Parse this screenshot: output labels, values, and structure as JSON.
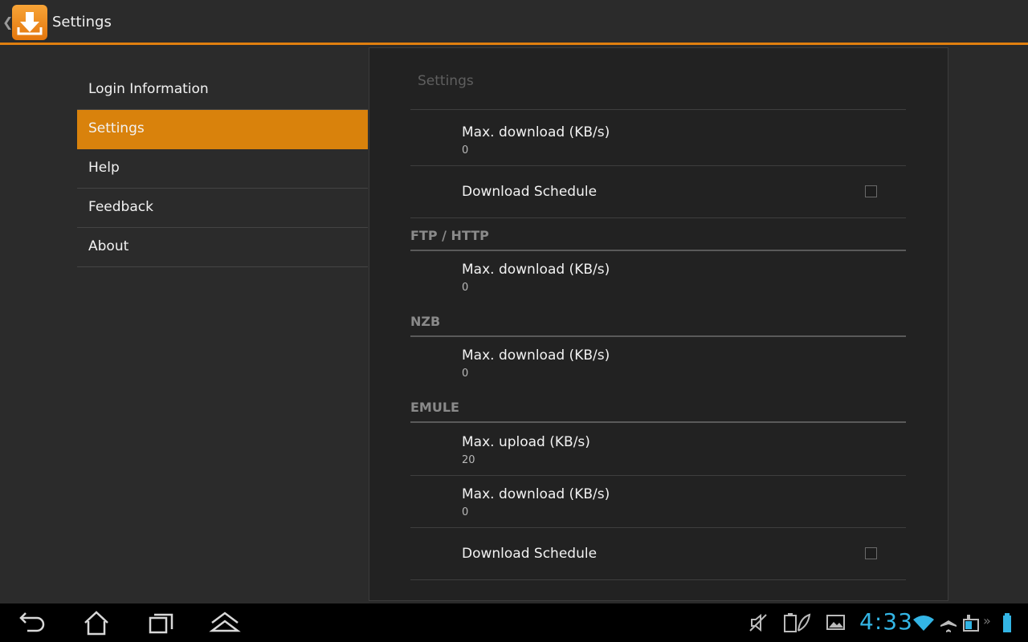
{
  "actionbar": {
    "title": "Settings"
  },
  "sidebar": {
    "items": [
      {
        "label": "Login Information",
        "selected": false
      },
      {
        "label": "Settings",
        "selected": true
      },
      {
        "label": "Help",
        "selected": false
      },
      {
        "label": "Feedback",
        "selected": false
      },
      {
        "label": "About",
        "selected": false
      }
    ]
  },
  "panel": {
    "title": "Settings",
    "prefs": [
      {
        "title": "Max. download (KB/s)",
        "summary": "0"
      },
      {
        "title": "Download Schedule",
        "checked": false
      }
    ],
    "categories": [
      {
        "name": "FTP / HTTP",
        "prefs": [
          {
            "title": "Max. download (KB/s)",
            "summary": "0"
          }
        ]
      },
      {
        "name": "NZB",
        "prefs": [
          {
            "title": "Max. download (KB/s)",
            "summary": "0"
          }
        ]
      },
      {
        "name": "EMULE",
        "prefs": [
          {
            "title": "Max. upload (KB/s)",
            "summary": "20"
          },
          {
            "title": "Max. download (KB/s)",
            "summary": "0"
          },
          {
            "title": "Download Schedule",
            "checked": false
          }
        ]
      }
    ]
  },
  "statusbar": {
    "time": "4:33"
  },
  "colors": {
    "accent": "#d9820c",
    "clock": "#33b5e5",
    "background": "#2a2a2a"
  }
}
